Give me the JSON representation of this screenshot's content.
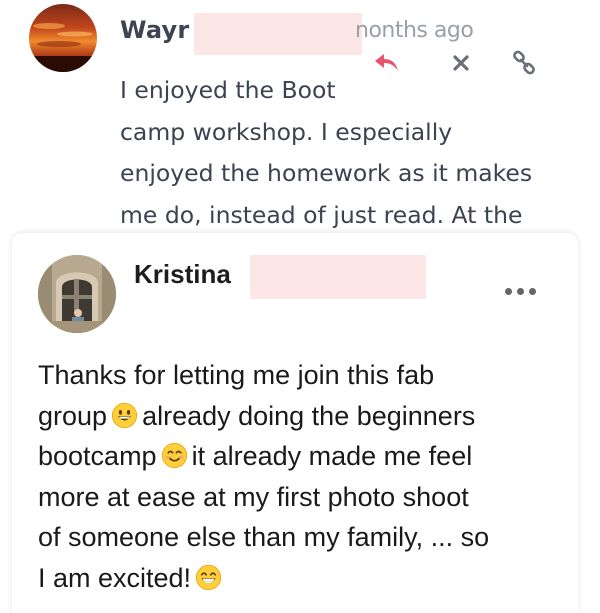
{
  "top_comment": {
    "author": "Wayr",
    "time": "nonths ago",
    "actions": {
      "reply_icon": "reply-icon",
      "delete_icon": "close-icon",
      "link_icon": "link-icon"
    },
    "text_lines": [
      "I enjoyed the Boot",
      "camp workshop.  I especially",
      "enjoyed the homework as it makes",
      "me do, instead of just read.  At the"
    ]
  },
  "post": {
    "author": "Kristina",
    "menu_icon": "more-dots-icon",
    "text": {
      "l1": "Thanks for letting me join this fab",
      "l2a": "group",
      "l2b": "already doing the beginners",
      "l3a": "bootcamp",
      "l3b": "it already made me feel",
      "l4": "more at ease at my first photo shoot",
      "l5": "of someone else than my family, ... so",
      "l6a": "I am excited!"
    },
    "emojis": [
      "grinning-face-emoji",
      "smiling-face-emoji",
      "beaming-face-emoji"
    ]
  },
  "colors": {
    "reply_accent": "#e8546b",
    "redaction": "#fde6e6",
    "muted_text": "#9aa0a8"
  }
}
